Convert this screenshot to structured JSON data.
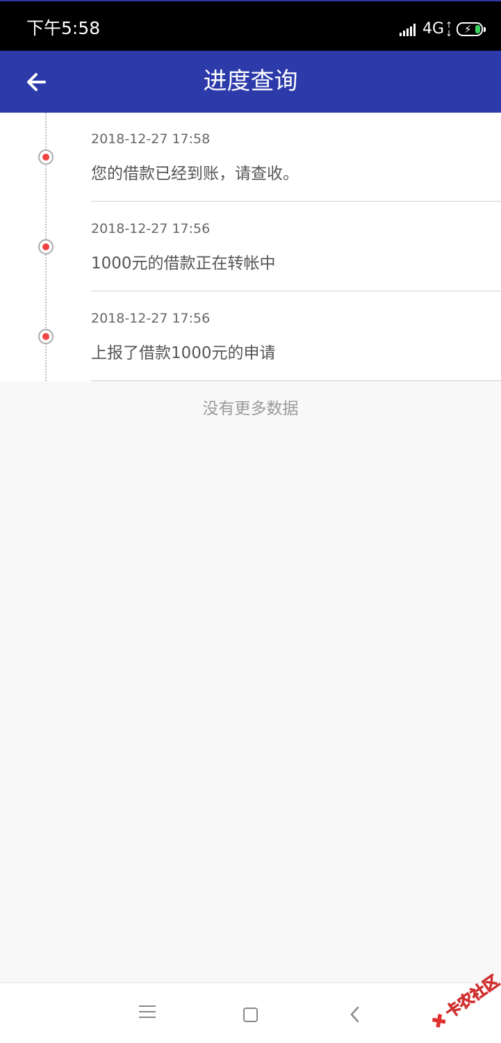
{
  "status_bar": {
    "time": "下午5:58",
    "network": "4G",
    "network_arrows": [
      "↑",
      "↓"
    ],
    "battery_bolt": "⚡",
    "icons": [
      "signal-icon",
      "battery-charging-icon"
    ]
  },
  "header": {
    "title": "进度查询",
    "back_icon": "arrow-left-icon"
  },
  "timeline": {
    "items": [
      {
        "time": "2018-12-27 17:58",
        "text": "您的借款已经到账，请查收。"
      },
      {
        "time": "2018-12-27 17:56",
        "text": "1000元的借款正在转帐中"
      },
      {
        "time": "2018-12-27 17:56",
        "text": "上报了借款1000元的申请"
      }
    ],
    "dot_color": "#f04444",
    "footer": "没有更多数据"
  },
  "navbar": {
    "icons": [
      "menu-icon",
      "home-icon",
      "back-icon"
    ]
  },
  "watermark": {
    "text": "卡农社区",
    "logo": "✖"
  },
  "colors": {
    "header_bg": "#2c3aaa",
    "status_bg": "#000000",
    "page_bg": "#f8f8f8"
  }
}
